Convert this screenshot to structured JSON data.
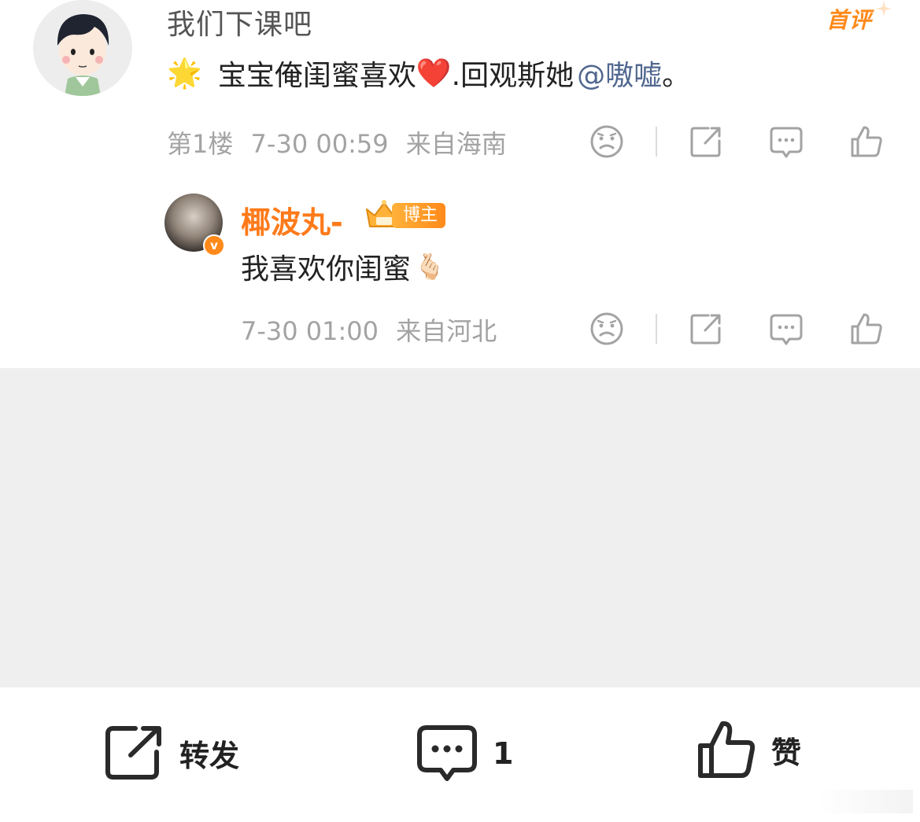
{
  "comment": {
    "username": "我们下课吧",
    "first_badge": "首评",
    "star_emoji": "🌟",
    "text_part1": "宝宝俺闺蜜喜欢",
    "heart_emoji": "❤️",
    "text_part2": ".回观斯她",
    "mention": "@嗷嘘",
    "text_end": "。",
    "floor": "第1楼",
    "time": "7-30 00:59",
    "location": "来自海南"
  },
  "reply": {
    "username": "椰波丸-",
    "badge": "博主",
    "verified_mark": "v",
    "text": "我喜欢你闺蜜",
    "emoji": "🫰🏻",
    "time": "7-30 01:00",
    "location": "来自河北"
  },
  "bottom_bar": {
    "repost_label": "转发",
    "comment_count": "1",
    "like_label": "赞"
  },
  "icons": {
    "dislike": "sad-face-icon",
    "share": "share-icon",
    "comment": "comment-bubble-icon",
    "like": "thumbs-up-icon"
  },
  "colors": {
    "accent": "#ff7a1a",
    "meta_gray": "#a3a3a3",
    "mention_blue": "#51678f",
    "background_gray": "#efefef"
  }
}
